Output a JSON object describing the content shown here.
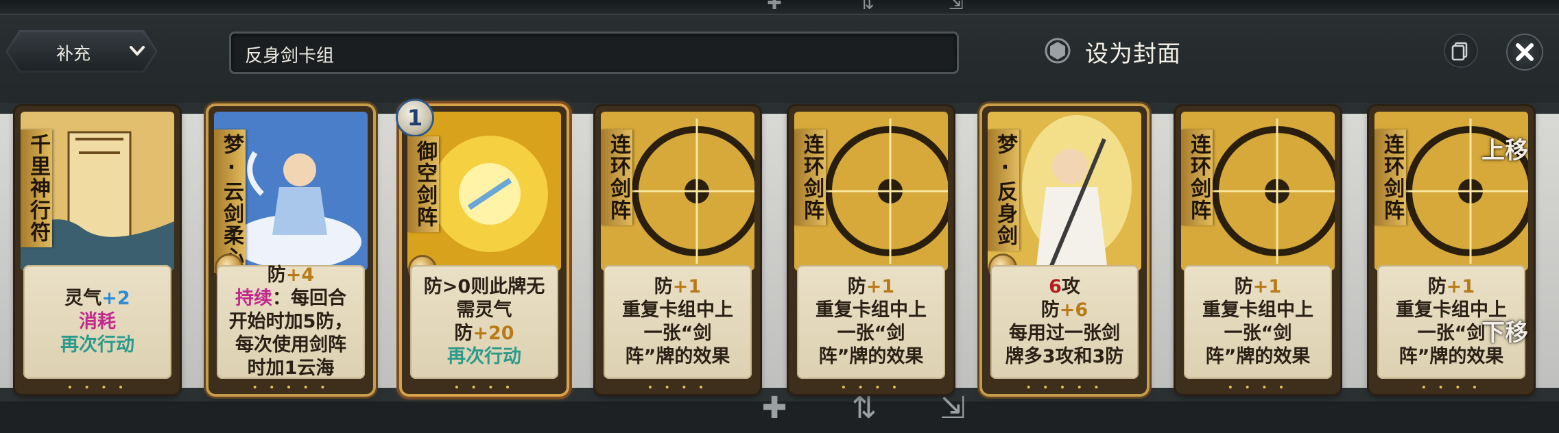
{
  "toolbar": {
    "dropdown_label": "补充",
    "deck_name": "反身剑卡组",
    "cover_label": "设为封面"
  },
  "side_controls": {
    "move_up": "上移",
    "move_down": "下移"
  },
  "cards": [
    {
      "title": "千里神行符",
      "lines": [
        [
          "灵气",
          "+2"
        ],
        [
          "消耗"
        ],
        [
          "再次行动"
        ]
      ]
    },
    {
      "title": "梦·云剑柔心",
      "lines": [
        [
          "防",
          "+4"
        ],
        [
          "持续",
          "：每回合"
        ],
        [
          "开始时加5防，"
        ],
        [
          "每次使用剑阵"
        ],
        [
          "时加1云海"
        ]
      ]
    },
    {
      "title": "御空剑阵",
      "cost": "1",
      "lines": [
        [
          "防>0则此牌无"
        ],
        [
          "需灵气"
        ],
        [
          "防",
          "+20"
        ],
        [
          "再次行动"
        ]
      ]
    },
    {
      "title": "连环剑阵",
      "lines": [
        [
          "防",
          "+1"
        ],
        [
          "重复卡组中上"
        ],
        [
          "一张“剑"
        ],
        [
          "阵”牌的效果"
        ]
      ]
    },
    {
      "title": "连环剑阵",
      "lines": [
        [
          "防",
          "+1"
        ],
        [
          "重复卡组中上"
        ],
        [
          "一张“剑"
        ],
        [
          "阵”牌的效果"
        ]
      ]
    },
    {
      "title": "梦·反身剑",
      "lines": [
        [
          "6",
          "攻"
        ],
        [
          "防",
          "+6"
        ],
        [
          "每用过一张剑"
        ],
        [
          "牌多3攻和3防"
        ]
      ]
    },
    {
      "title": "连环剑阵",
      "lines": [
        [
          "防",
          "+1"
        ],
        [
          "重复卡组中上"
        ],
        [
          "一张“剑"
        ],
        [
          "阵”牌的效果"
        ]
      ]
    },
    {
      "title": "连环剑阵",
      "lines": [
        [
          "防",
          "+1"
        ],
        [
          "重复卡组中上"
        ],
        [
          "一张“剑"
        ],
        [
          "阵”牌的效果"
        ]
      ]
    }
  ]
}
